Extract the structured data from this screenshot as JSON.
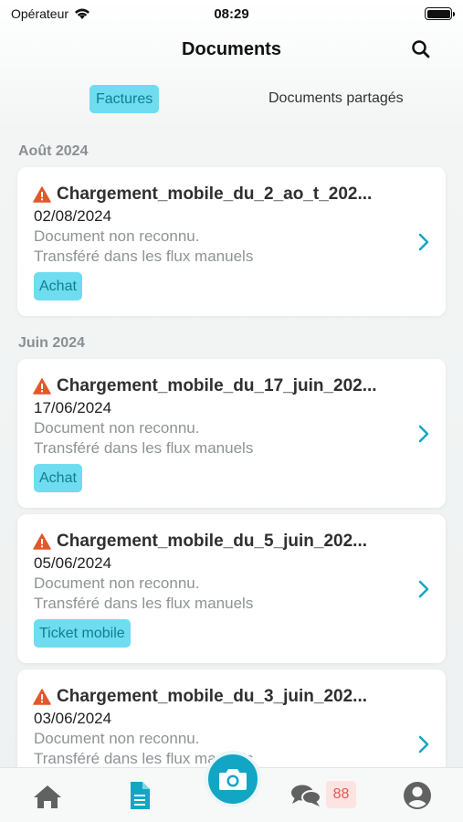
{
  "status_bar": {
    "carrier": "Opérateur",
    "time": "08:29"
  },
  "header": {
    "title": "Documents"
  },
  "tabs": [
    {
      "label": "Factures",
      "active": true
    },
    {
      "label": "Documents partagés",
      "active": false
    }
  ],
  "sections": [
    {
      "title": "Août 2024",
      "cards": [
        {
          "title": "Chargement_mobile_du_2_ao_t_202...",
          "date": "02/08/2024",
          "line1": "Document non reconnu.",
          "line2": "Transféré dans les flux manuels",
          "badge": "Achat"
        }
      ]
    },
    {
      "title": "Juin 2024",
      "cards": [
        {
          "title": "Chargement_mobile_du_17_juin_202...",
          "date": "17/06/2024",
          "line1": "Document non reconnu.",
          "line2": "Transféré dans les flux manuels",
          "badge": "Achat"
        },
        {
          "title": "Chargement_mobile_du_5_juin_202...",
          "date": "05/06/2024",
          "line1": "Document non reconnu.",
          "line2": "Transféré dans les flux manuels",
          "badge": "Ticket mobile"
        },
        {
          "title": "Chargement_mobile_du_3_juin_202...",
          "date": "03/06/2024",
          "line1": "Document non reconnu.",
          "line2": "Transféré dans les flux manuels"
        }
      ]
    }
  ],
  "tabbar": {
    "items": [
      "home-icon",
      "document-icon",
      "camera-icon",
      "chat-icon",
      "profile-icon"
    ],
    "chat_count": "88"
  },
  "colors": {
    "accent": "#12a6c4",
    "badge_bg": "#6fdcf0",
    "badge_text": "#0d7f93",
    "warning": "#e3572c",
    "count_bg": "#fde3e1",
    "count_text": "#e45a4f"
  }
}
